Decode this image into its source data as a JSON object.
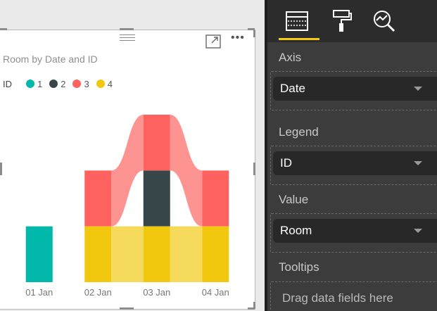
{
  "visual": {
    "title": "Room by Date and ID",
    "header_icons": [
      "drag-grip-icon",
      "focus-mode-icon",
      "more-options-icon"
    ],
    "legend": {
      "title": "ID",
      "items": [
        {
          "label": "1",
          "color": "#01b8aa"
        },
        {
          "label": "2",
          "color": "#374649"
        },
        {
          "label": "3",
          "color": "#fd625e"
        },
        {
          "label": "4",
          "color": "#f2c80f"
        }
      ]
    }
  },
  "chart_data": {
    "type": "bar",
    "subtype": "ribbon",
    "title": "Room by Date and ID",
    "categories": [
      "01 Jan",
      "02 Jan",
      "03 Jan",
      "04 Jan"
    ],
    "series": [
      {
        "name": "1",
        "color": "#01b8aa",
        "values": [
          1,
          0,
          0,
          0
        ]
      },
      {
        "name": "2",
        "color": "#374649",
        "values": [
          0,
          0,
          1,
          0
        ]
      },
      {
        "name": "3",
        "color": "#fd625e",
        "values": [
          0,
          1,
          1,
          1
        ]
      },
      {
        "name": "4",
        "color": "#f2c80f",
        "values": [
          0,
          1,
          1,
          1
        ]
      }
    ],
    "stack_order": [
      "4",
      "2",
      "3"
    ],
    "ylim": [
      0,
      3.0
    ],
    "grid": false,
    "legend_position": "top-left"
  },
  "pane": {
    "tabs": [
      {
        "icon": "fields-icon",
        "active": true
      },
      {
        "icon": "format-paint-roller-icon",
        "active": false
      },
      {
        "icon": "analytics-magnifier-icon",
        "active": false
      }
    ],
    "accent_color": "#f2c811",
    "axis": {
      "label": "Axis",
      "field": "Date"
    },
    "legend": {
      "label": "Legend",
      "field": "ID"
    },
    "value": {
      "label": "Value",
      "field": "Room"
    },
    "tooltips": {
      "label": "Tooltips",
      "placeholder": "Drag data fields here"
    }
  }
}
